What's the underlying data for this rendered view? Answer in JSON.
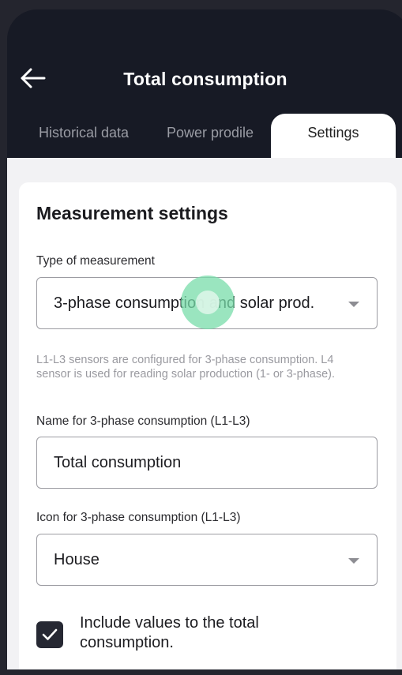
{
  "header": {
    "title": "Total consumption"
  },
  "tabs": [
    {
      "label": "Historical data",
      "active": false
    },
    {
      "label": "Power prodile",
      "active": false
    },
    {
      "label": "Settings",
      "active": true
    }
  ],
  "card": {
    "title": "Measurement settings",
    "measurement_type": {
      "label": "Type of measurement",
      "value": "3-phase consumption and solar prod.",
      "help": "L1-L3 sensors are configured for 3-phase consumption. L4 sensor is used for reading solar production (1- or 3-phase)."
    },
    "name_field": {
      "label": "Name for 3-phase consumption (L1-L3)",
      "value": "Total consumption"
    },
    "icon_field": {
      "label": "Icon for 3-phase consumption (L1-L3)",
      "value": "House"
    },
    "include_checkbox": {
      "label": "Include values to the total consumption.",
      "checked": true
    }
  },
  "colors": {
    "header_bg": "#171a25",
    "tab_active_bg": "#ffffff",
    "touch_indicator": "#78dcaa",
    "checkbox_bg": "#262833"
  },
  "icons": {
    "back": "arrow-left-icon",
    "dropdown": "caret-down-icon",
    "check": "check-icon"
  }
}
